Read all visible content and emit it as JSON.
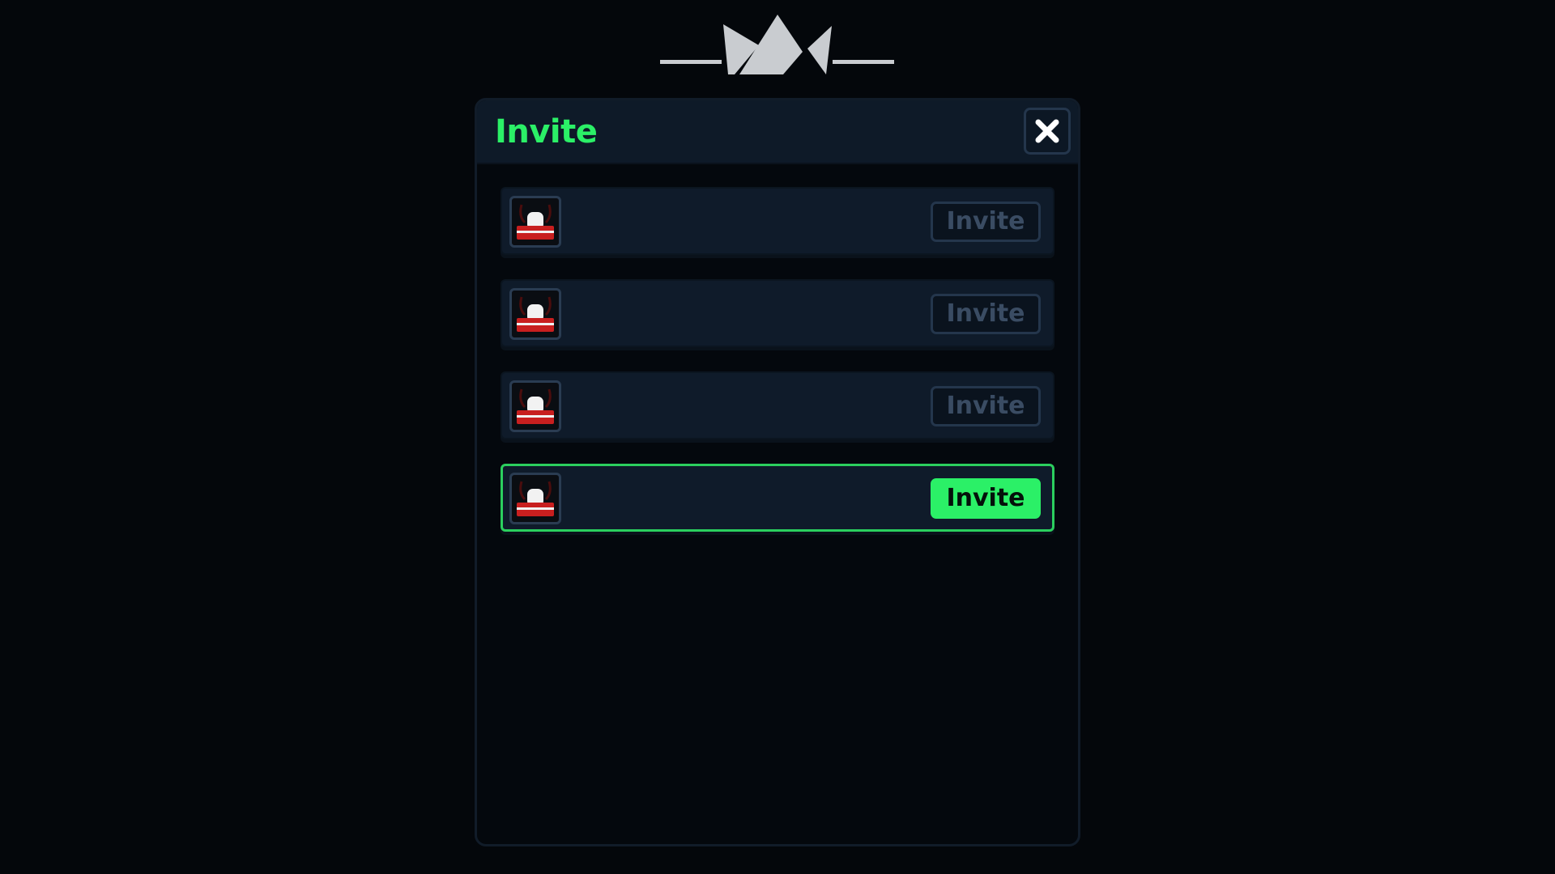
{
  "dialog": {
    "title": "Invite",
    "close_icon": "close-icon"
  },
  "colors": {
    "accent": "#2bf067",
    "panel_bg": "#0e1a28",
    "page_bg": "#04070b",
    "disabled_text": "#3a4c63"
  },
  "players": [
    {
      "avatar_icon": "player-avatar-icon",
      "button_label": "Invite",
      "state": "disabled"
    },
    {
      "avatar_icon": "player-avatar-icon",
      "button_label": "Invite",
      "state": "disabled"
    },
    {
      "avatar_icon": "player-avatar-icon",
      "button_label": "Invite",
      "state": "disabled"
    },
    {
      "avatar_icon": "player-avatar-icon",
      "button_label": "Invite",
      "state": "active"
    }
  ]
}
